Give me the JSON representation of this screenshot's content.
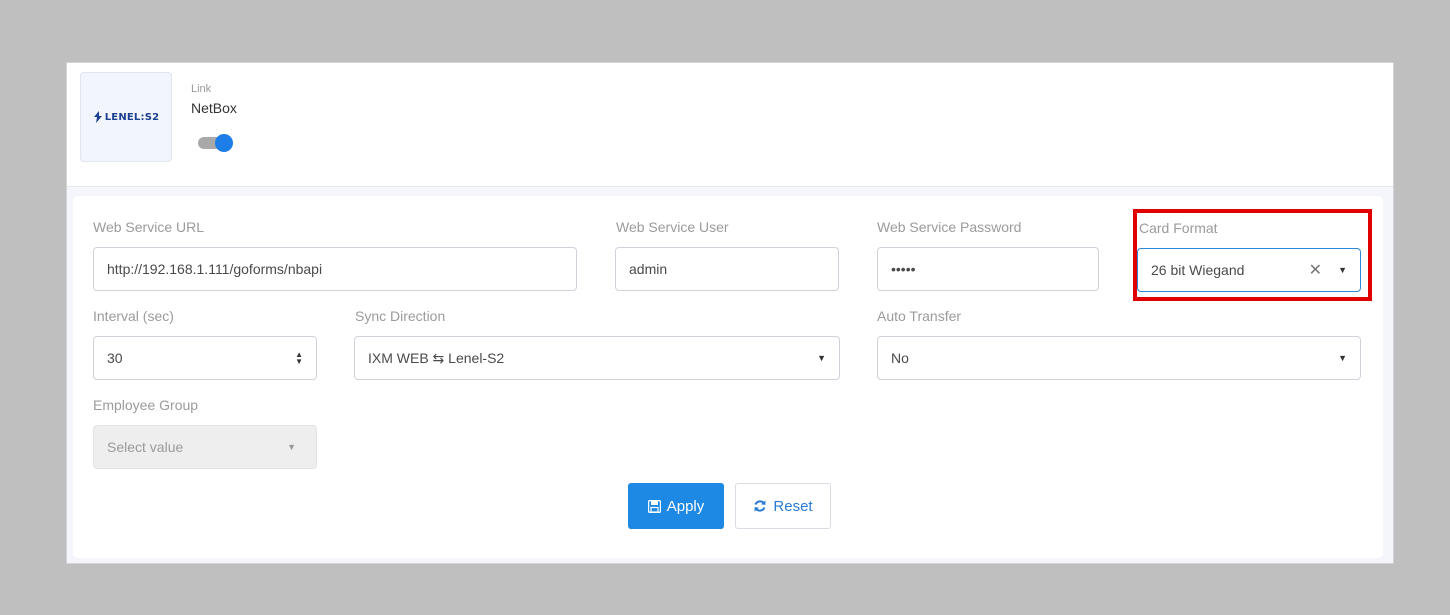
{
  "header": {
    "logo_text": "LENEL:S2",
    "link_label": "Link",
    "link_name": "NetBox",
    "toggle_on": true
  },
  "form": {
    "web_service_url": {
      "label": "Web Service URL",
      "value": "http://192.168.1.111/goforms/nbapi"
    },
    "web_service_user": {
      "label": "Web Service User",
      "value": "admin"
    },
    "web_service_password": {
      "label": "Web Service Password",
      "value": "•••••"
    },
    "card_format": {
      "label": "Card Format",
      "value": "26 bit Wiegand"
    },
    "interval": {
      "label": "Interval (sec)",
      "value": "30"
    },
    "sync_direction": {
      "label": "Sync Direction",
      "value": "IXM WEB ⇆ Lenel-S2"
    },
    "auto_transfer": {
      "label": "Auto Transfer",
      "value": "No"
    },
    "employee_group": {
      "label": "Employee Group",
      "placeholder": "Select value"
    }
  },
  "buttons": {
    "apply": "Apply",
    "reset": "Reset"
  },
  "colors": {
    "primary": "#1e88e5",
    "highlight": "#e00000",
    "toggle_knob": "#1e7ee8"
  },
  "icons": {
    "apply": "save-icon",
    "reset": "refresh-icon",
    "dropdown": "caret-down-icon",
    "clear": "close-icon"
  }
}
